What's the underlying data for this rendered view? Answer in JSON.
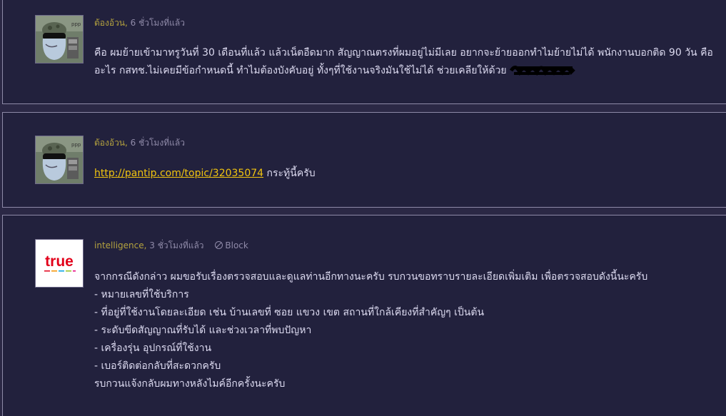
{
  "comments": [
    {
      "author": "ต้องอ้วน",
      "time": "6 ชั่วโมงที่แล้ว",
      "avatar_icon": "cartoon-character-avatar-icon",
      "text": "คือ ผมย้ายเข้ามาทรูวันที่ 30 เดือนที่แล้ว แล้วเน็ตอืดมาก สัญญาณตรงที่ผมอยู่ไม่มีเลย อยากจะย้ายออกทำไมย้ายไม่ได้ พนักงานบอกติด 90 วัน คืออะไร กสทช.ไม่เคยมีข้อกำหนดนี้ ทำไมต้องบังคับอยู่ ทั้งๆที่ใช้งานจริงมันใช้ไม่ได้ ช่วยเคลียให้ด้วย"
    },
    {
      "author": "ต้องอ้วน",
      "time": "6 ชั่วโมงที่แล้ว",
      "avatar_icon": "cartoon-character-avatar-icon",
      "link": "http://pantip.com/topic/32035074",
      "text": " กระทู้นี้ครับ"
    },
    {
      "author": "intelligence",
      "time": "3 ชั่วโมงที่แล้ว",
      "avatar_icon": "true-logo-icon",
      "logo_text": "true",
      "block_label": "Block",
      "lines": [
        "จากกรณีดังกล่าว ผมขอรับเรื่องตรวจสอบและดูแลท่านอีกทางนะครับ รบกวนขอทราบรายละเอียดเพิ่มเติม เพื่อตรวจสอบดังนี้นะครับ",
        "- หมายเลขที่ใช้บริการ",
        "- ที่อยู่ที่ใช้งานโดยละเอียด เช่น บ้านเลขที่ ซอย แขวง เขต สถานที่ใกล้เคียงที่สำคัญๆ เป็นต้น",
        "- ระดับขีดสัญญาณที่รับได้ และช่วงเวลาที่พบปัญหา",
        "- เครื่องรุ่น อุปกรณ์ที่ใช้งาน",
        "- เบอร์ติดต่อกลับที่สะดวกครับ",
        "รบกวนแจ้งกลับผมทางหลังไมค์อีกครั้งนะครับ"
      ]
    }
  ],
  "colors": {
    "background": "#2b2845",
    "card": "#22213d",
    "author": "#b4a23e",
    "text": "#dcdaf0",
    "link": "#f1c40f",
    "true_red": "#e2001a"
  }
}
